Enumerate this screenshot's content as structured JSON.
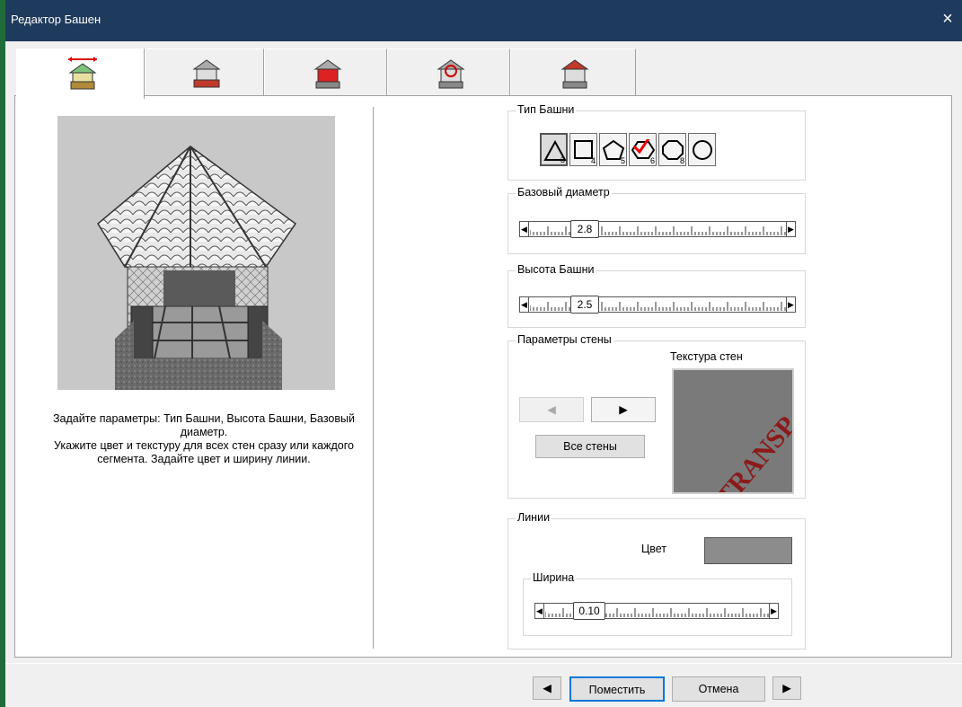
{
  "window": {
    "title": "Редактор Башен",
    "close_icon": "×"
  },
  "tabs": [
    {
      "name": "tower-size-tab",
      "active": true
    },
    {
      "name": "tower-base-tab",
      "active": false
    },
    {
      "name": "tower-walls-tab",
      "active": false
    },
    {
      "name": "tower-rail-tab",
      "active": false
    },
    {
      "name": "tower-roof-tab",
      "active": false
    }
  ],
  "description": "Задайте параметры: Тип Башни, Высота Башни, Базовый диаметр.\nУкажите цвет и текстуру для всех стен сразу или каждого сегмента. Задайте цвет и ширину линии.",
  "tower_type": {
    "label": "Тип Башни",
    "buttons": [
      {
        "shape": "triangle",
        "sides": "3",
        "selected": true
      },
      {
        "shape": "square",
        "sides": "4",
        "selected": false
      },
      {
        "shape": "pentagon",
        "sides": "5",
        "selected": false
      },
      {
        "shape": "hexagon",
        "sides": "6",
        "selected": false,
        "checked": true
      },
      {
        "shape": "octagon",
        "sides": "8",
        "selected": false
      },
      {
        "shape": "circle",
        "sides": "",
        "selected": false
      }
    ]
  },
  "base_diameter": {
    "label": "Базовый диаметр",
    "value": "2.8"
  },
  "tower_height": {
    "label": "Высота Башни",
    "value": "2.5"
  },
  "wall_params": {
    "label": "Параметры стены",
    "texture_label": "Текстура стен",
    "all_walls_button": "Все стены",
    "texture_text": "TRANSP"
  },
  "lines": {
    "label": "Линии",
    "color_label": "Цвет",
    "color_value": "#8c8c8c",
    "width_label": "Ширина",
    "width_value": "0.10"
  },
  "footer": {
    "place_button": "Поместить",
    "cancel_button": "Отмена"
  },
  "colors": {
    "titlebar": "#1e3a5c",
    "border_green": "#1f6b3a",
    "texture_text": "#8b1a1a"
  }
}
